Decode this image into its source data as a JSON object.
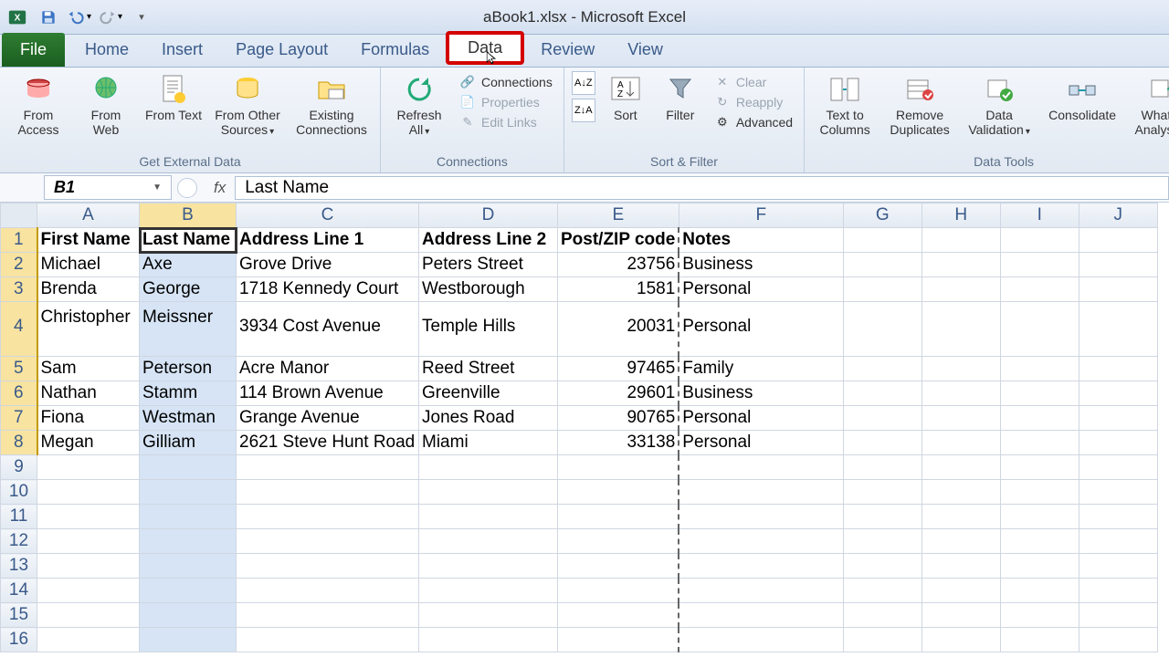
{
  "title": "aBook1.xlsx - Microsoft Excel",
  "tabs": {
    "file": "File",
    "home": "Home",
    "insert": "Insert",
    "page_layout": "Page Layout",
    "formulas": "Formulas",
    "data": "Data",
    "review": "Review",
    "view": "View"
  },
  "ribbon": {
    "get_external_data": {
      "label": "Get External Data",
      "from_access": "From Access",
      "from_web": "From Web",
      "from_text": "From Text",
      "from_other": "From Other Sources",
      "existing": "Existing Connections"
    },
    "connections": {
      "label": "Connections",
      "refresh_all": "Refresh All",
      "connections": "Connections",
      "properties": "Properties",
      "edit_links": "Edit Links"
    },
    "sort_filter": {
      "label": "Sort & Filter",
      "sort": "Sort",
      "filter": "Filter",
      "clear": "Clear",
      "reapply": "Reapply",
      "advanced": "Advanced"
    },
    "data_tools": {
      "label": "Data Tools",
      "text_to_columns": "Text to Columns",
      "remove_duplicates": "Remove Duplicates",
      "data_validation": "Data Validation",
      "consolidate": "Consolidate",
      "what_if": "What-If Analysis"
    }
  },
  "namebox": "B1",
  "fx_label": "fx",
  "formula_value": "Last Name",
  "columns": [
    "A",
    "B",
    "C",
    "D",
    "E",
    "F",
    "G",
    "H",
    "I",
    "J"
  ],
  "selected_column": "B",
  "row_count": 16,
  "headers": [
    "First Name",
    "Last Name",
    "Address Line 1",
    "Address Line 2",
    "Post/ZIP code",
    "Notes"
  ],
  "rows": [
    [
      "Michael",
      "Axe",
      "Grove Drive",
      "Peters Street",
      "23756",
      "Business"
    ],
    [
      "Brenda",
      "George",
      "1718 Kennedy Court",
      "Westborough",
      "1581",
      "Personal"
    ],
    [
      "Christopher",
      "Meissner",
      "3934 Cost Avenue",
      "Temple Hills",
      "20031",
      "Personal"
    ],
    [
      "Sam",
      "Peterson",
      "Acre Manor",
      "Reed Street",
      "97465",
      "Family"
    ],
    [
      "Nathan",
      "Stamm",
      "114 Brown Avenue",
      "Greenville",
      "29601",
      "Business"
    ],
    [
      "Fiona",
      "Westman",
      "Grange Avenue",
      "Jones Road",
      "90765",
      "Personal"
    ],
    [
      "Megan",
      "Gilliam",
      "2621 Steve Hunt Road",
      "Miami",
      "33138",
      "Personal"
    ]
  ],
  "colors": {
    "accent": "#1b5e20",
    "highlight": "#d40000",
    "selection": "#d6e4f5"
  }
}
